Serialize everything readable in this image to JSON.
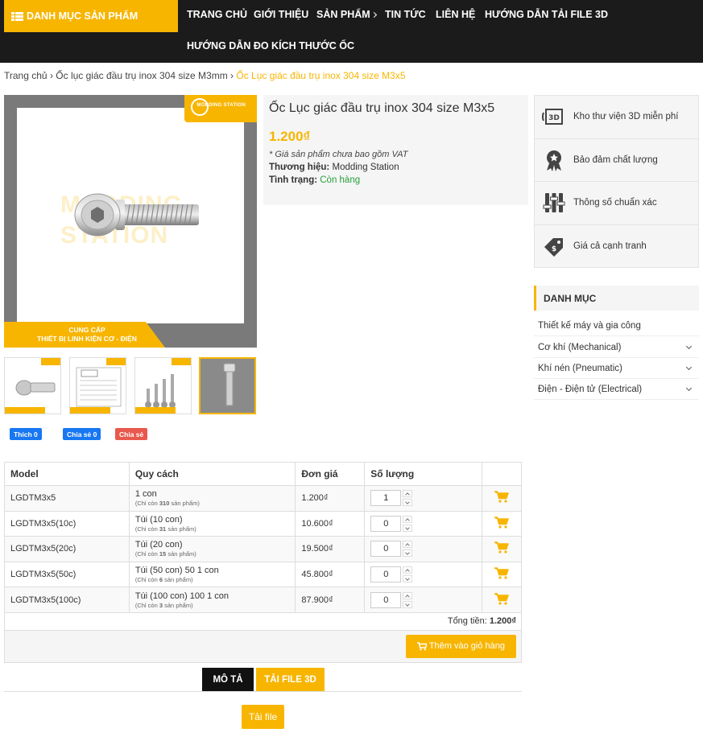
{
  "nav": {
    "category_button": "DANH MỤC SẢN PHẨM",
    "menu": [
      "TRANG CHỦ",
      "GIỚI THIỆU",
      "SẢN PHẨM",
      "TIN TỨC",
      "LIÊN HỆ",
      "HƯỚNG DẪN TẢI FILE 3D",
      "HƯỚNG DẪN ĐO KÍCH THƯỚC ỐC"
    ]
  },
  "breadcrumb": {
    "items": [
      "Trang chủ",
      "Ốc lục giác đầu trụ inox 304 size M3mm"
    ],
    "current": "Ốc Lục giác đầu trụ inox 304 size M3x5",
    "separator": "›"
  },
  "gallery": {
    "main": {
      "brand_text": "MODDING STATION",
      "watermark_line1": "MODDING",
      "watermark_line2": "STATION",
      "caption_line1": "CUNG CẤP",
      "caption_line2": "THIẾT BỊ LINH KIỆN CƠ - ĐIỆN"
    }
  },
  "social": {
    "like": "Thích 0",
    "share": "Chia sẻ 0",
    "plus": "Chia sẻ"
  },
  "product": {
    "title": "Ốc Lục giác đầu trụ inox 304 size M3x5",
    "price": "1.200₫",
    "vat_note": "* Giá sản phẩm chưa bao gồm VAT",
    "brand_label": "Thương hiệu:",
    "brand_value": "Modding Station",
    "status_label": "Tình trạng:",
    "status_value": "Còn hàng"
  },
  "features": [
    {
      "label": "Kho thư viện 3D miễn phí",
      "icon": "3d-box-icon"
    },
    {
      "label": "Bảo đảm chất lượng",
      "icon": "quality-badge-icon"
    },
    {
      "label": "Thông số chuẩn xác",
      "icon": "sliders-icon"
    },
    {
      "label": "Giá cả cạnh tranh",
      "icon": "price-tag-icon"
    }
  ],
  "danh_muc": {
    "heading": "DANH MỤC",
    "items": [
      "Thiết kế máy và gia công",
      "Cơ khí (Mechanical)",
      "Khí nén (Pneumatic)",
      "Điện - Điện tử (Electrical)"
    ]
  },
  "table": {
    "headers": [
      "Model",
      "Quy cách",
      "Đơn giá",
      "Số lượng",
      ""
    ],
    "sub_prefix": "(Chỉ còn",
    "sub_suffix": "sản phẩm)",
    "rows": [
      {
        "model": "LGDTM3x5",
        "spec": "1 con",
        "stock": "310",
        "price": "1.200₫",
        "qty": "1"
      },
      {
        "model": "LGDTM3x5(10c)",
        "spec": "Túi (10 con)",
        "stock": "31",
        "price": "10.600₫",
        "qty": "0"
      },
      {
        "model": "LGDTM3x5(20c)",
        "spec": "Túi (20 con)",
        "stock": "15",
        "price": "19.500₫",
        "qty": "0"
      },
      {
        "model": "LGDTM3x5(50c)",
        "spec": "Túi (50 con) 50 1 con",
        "stock": "6",
        "price": "45.800₫",
        "qty": "0"
      },
      {
        "model": "LGDTM3x5(100c)",
        "spec": "Túi (100 con) 100 1 con",
        "stock": "3",
        "price": "87.900₫",
        "qty": "0"
      }
    ],
    "total_label": "Tổng tiền:",
    "total_value": "1.200₫",
    "add_to_cart": "Thêm vào giỏ hàng"
  },
  "tabs": {
    "description": "MÔ TẢ",
    "download": "TẢI FILE 3D",
    "download_button": "Tải file"
  },
  "colors": {
    "accent": "#f7b500",
    "nav_bg": "#1b1b1b",
    "in_stock": "#27a03a",
    "facebook": "#1877f2"
  }
}
